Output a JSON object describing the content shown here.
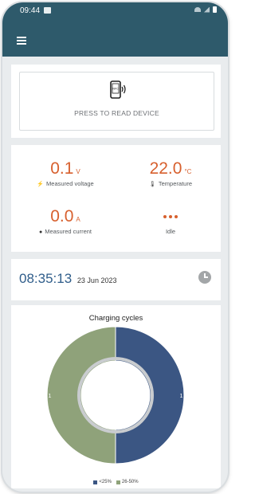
{
  "status_bar": {
    "time": "09:44"
  },
  "nfc": {
    "icon_text": "NFC",
    "label": "PRESS TO READ DEVICE"
  },
  "metrics": {
    "voltage": {
      "value": "0.1",
      "unit": "V",
      "label": "Measured voltage"
    },
    "temperature": {
      "value": "22.0",
      "unit": "°C",
      "label": "Temperature"
    },
    "current": {
      "value": "0.0",
      "unit": "A",
      "label": "Measured current"
    },
    "state": {
      "label": "Idle"
    }
  },
  "datetime": {
    "time": "08:35:13",
    "date": "23 Jun 2023"
  },
  "colors": {
    "primary": "#2e5a6b",
    "accent": "#d7602e",
    "time_text": "#2f5d8a"
  },
  "chart_data": {
    "type": "pie",
    "title": "Charging cycles",
    "categories": [
      "<25%",
      "26-50%"
    ],
    "values": [
      1,
      1
    ],
    "colors": [
      "#3b5683",
      "#8fa27a"
    ],
    "donut": true
  }
}
